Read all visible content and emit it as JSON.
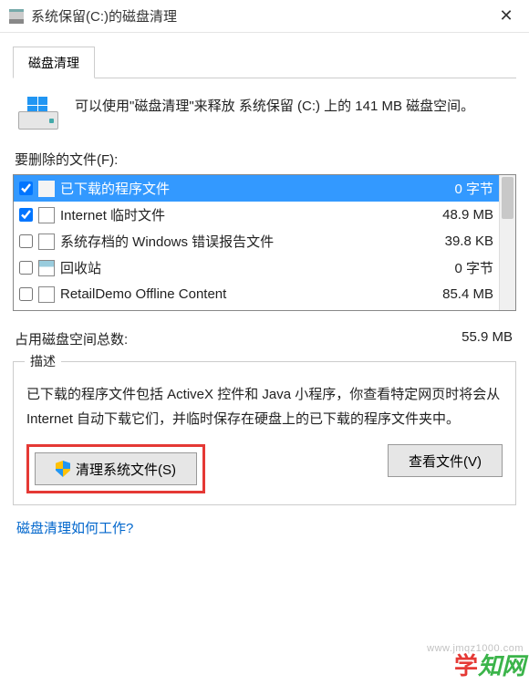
{
  "window": {
    "title": "系统保留(C:)的磁盘清理"
  },
  "tab": {
    "label": "磁盘清理"
  },
  "intro": "可以使用\"磁盘清理\"来释放 系统保留 (C:) 上的 141 MB 磁盘空间。",
  "filesLabel": "要删除的文件(F):",
  "files": [
    {
      "name": "已下载的程序文件",
      "size": "0 字节",
      "checked": true,
      "selected": true,
      "iconType": "blank"
    },
    {
      "name": "Internet 临时文件",
      "size": "48.9 MB",
      "checked": true,
      "selected": false,
      "iconType": "ie"
    },
    {
      "name": "系统存档的 Windows 错误报告文件",
      "size": "39.8 KB",
      "checked": false,
      "selected": false,
      "iconType": "doc"
    },
    {
      "name": "回收站",
      "size": "0 字节",
      "checked": false,
      "selected": false,
      "iconType": "recycle"
    },
    {
      "name": "RetailDemo Offline Content",
      "size": "85.4 MB",
      "checked": false,
      "selected": false,
      "iconType": "doc"
    }
  ],
  "total": {
    "label": "占用磁盘空间总数:",
    "value": "55.9 MB"
  },
  "group": {
    "legend": "描述",
    "desc": "已下载的程序文件包括 ActiveX 控件和 Java 小程序，你查看特定网页时将会从 Internet 自动下载它们，并临时保存在硬盘上的已下载的程序文件夹中。"
  },
  "buttons": {
    "cleanSystem": "清理系统文件(S)",
    "viewFiles": "查看文件(V)"
  },
  "link": "磁盘清理如何工作?",
  "watermark": {
    "a": "学",
    "b": "知网"
  },
  "watermark_url": "www.jmqz1000.com"
}
